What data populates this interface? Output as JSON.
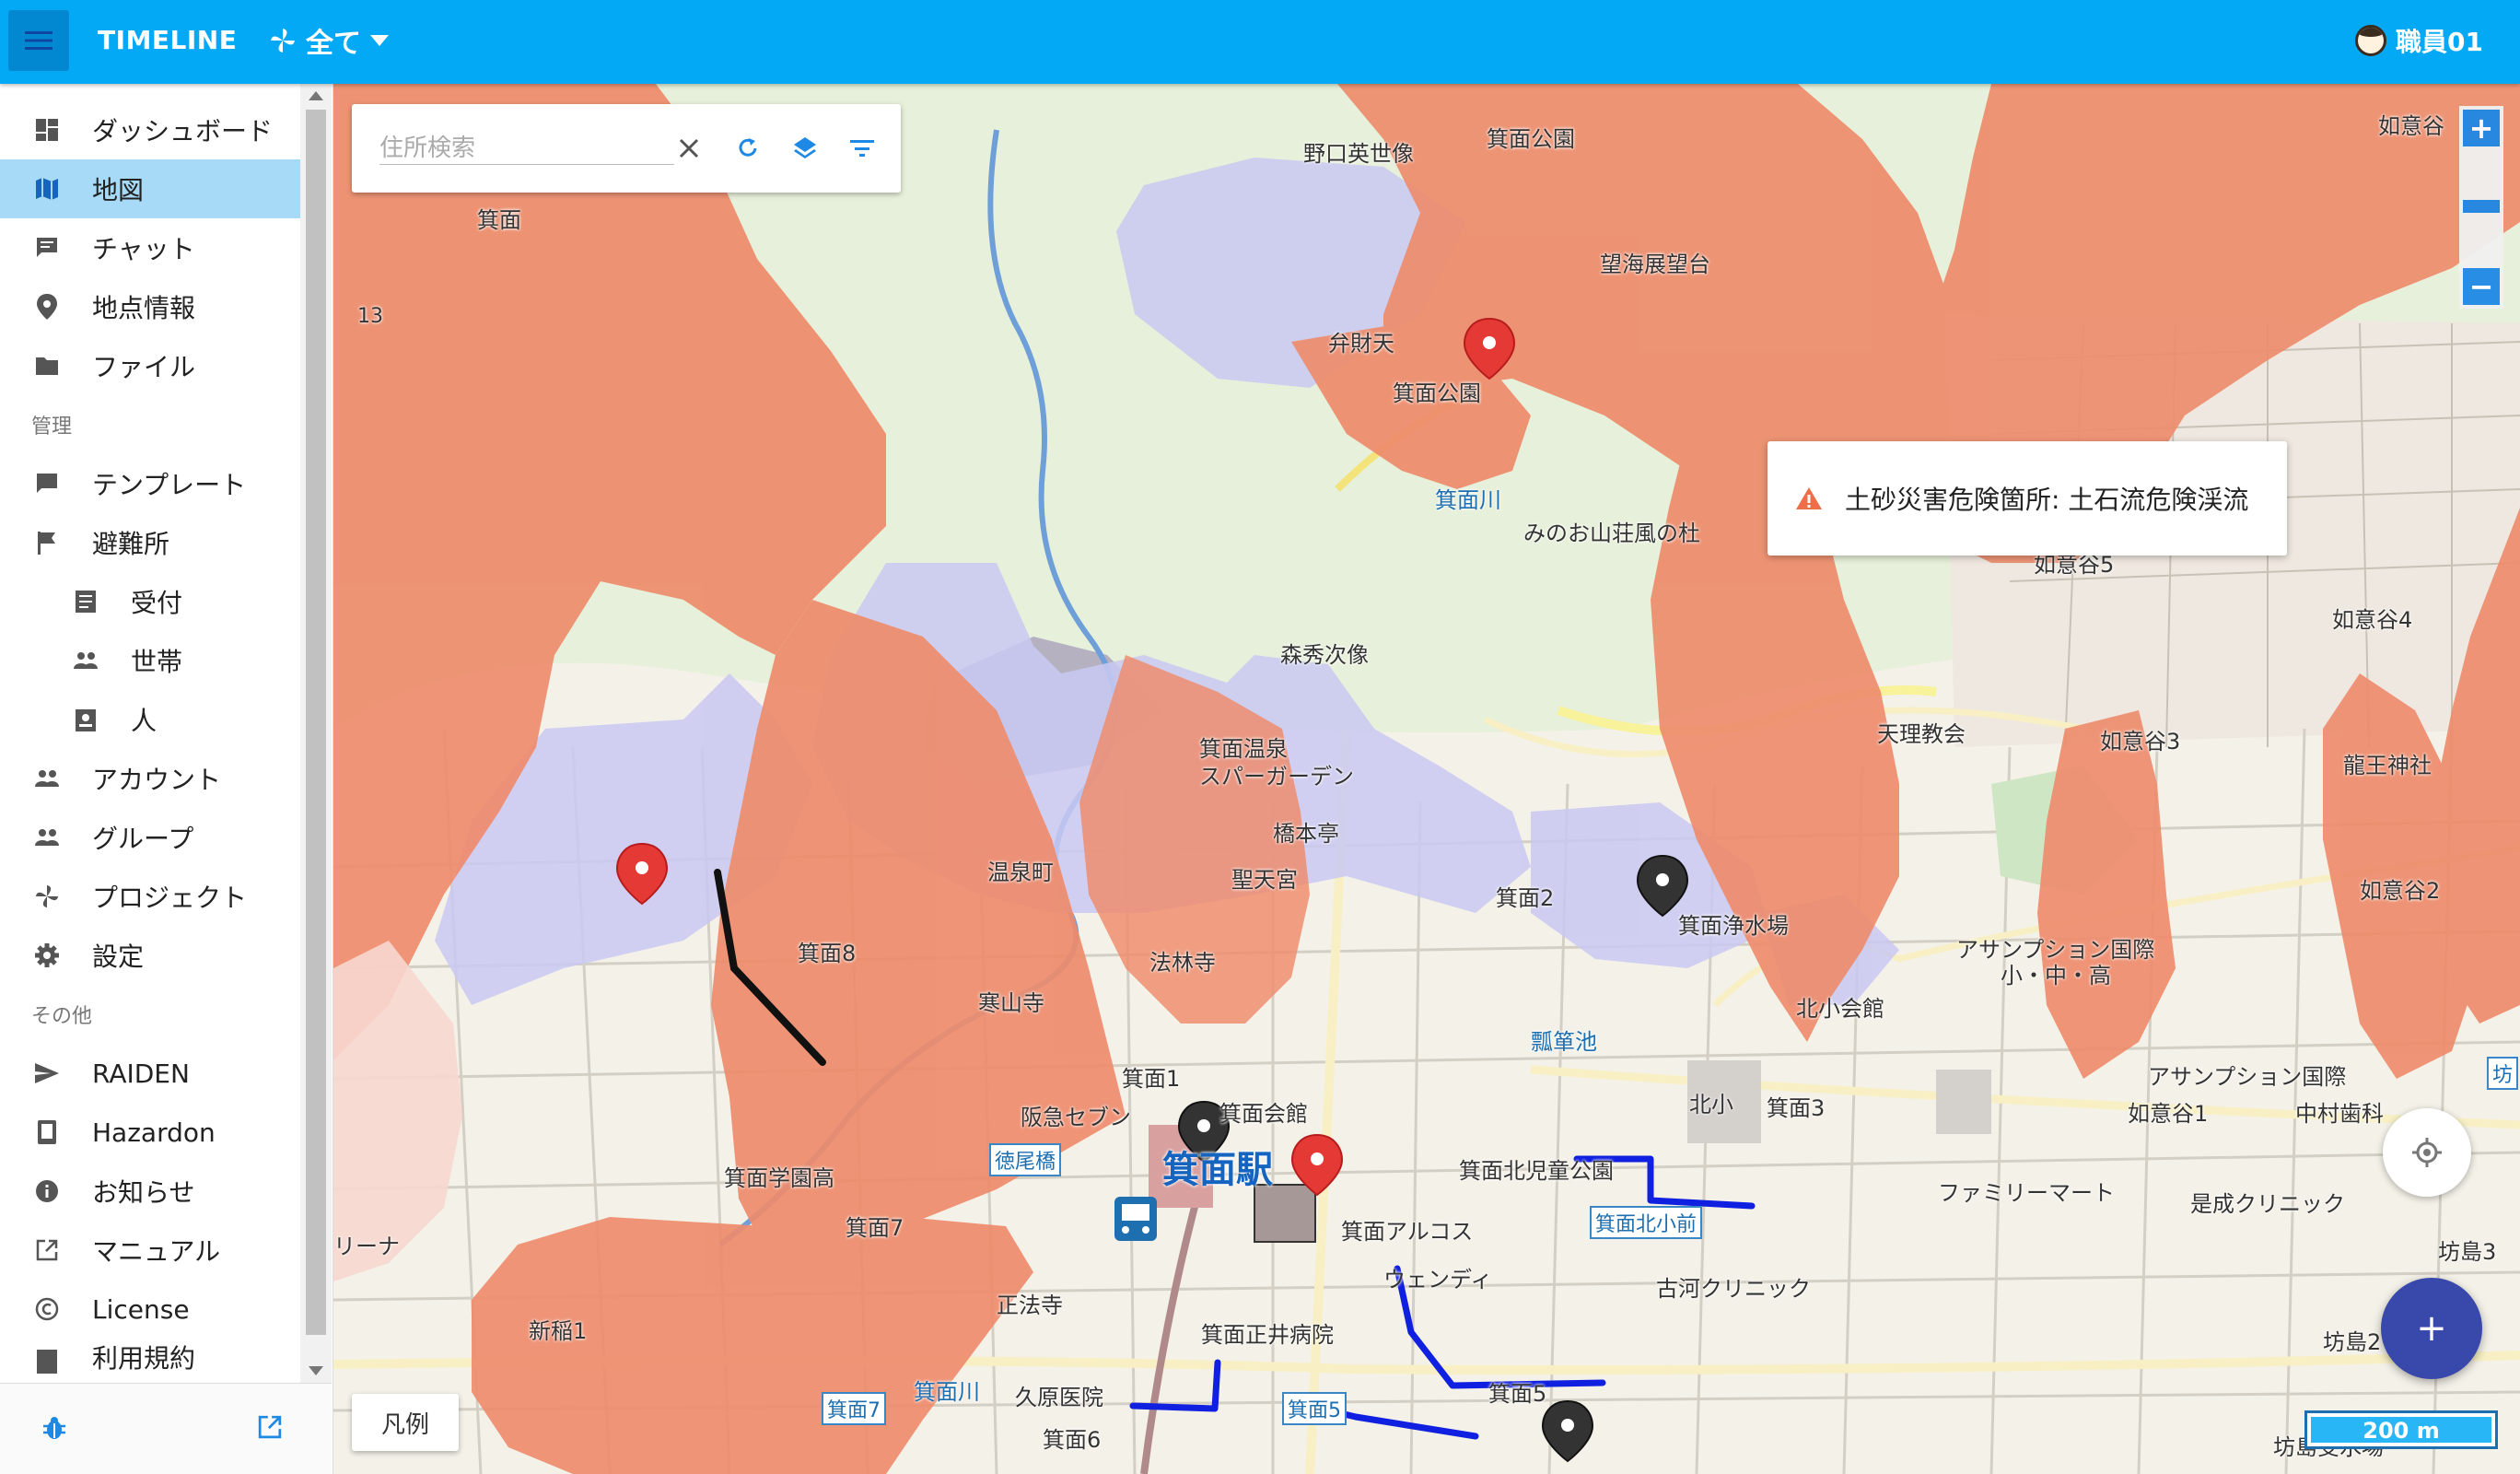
{
  "header": {
    "app_title": "TIMELINE",
    "project_label": "全て",
    "user_name": "職員01"
  },
  "sidebar": {
    "main_items": [
      {
        "label": "ダッシュボード",
        "icon": "dashboard-icon"
      },
      {
        "label": "地図",
        "icon": "map-icon",
        "active": true
      },
      {
        "label": "チャット",
        "icon": "chat-icon"
      },
      {
        "label": "地点情報",
        "icon": "location-pin-icon"
      },
      {
        "label": "ファイル",
        "icon": "folder-icon"
      }
    ],
    "section_admin": "管理",
    "admin_items": [
      {
        "label": "テンプレート",
        "icon": "template-icon"
      },
      {
        "label": "避難所",
        "icon": "flag-icon"
      },
      {
        "label": "受付",
        "icon": "list-icon",
        "sub": true
      },
      {
        "label": "世帯",
        "icon": "people-icon",
        "sub": true
      },
      {
        "label": "人",
        "icon": "badge-icon",
        "sub": true
      },
      {
        "label": "アカウント",
        "icon": "people-icon"
      },
      {
        "label": "グループ",
        "icon": "people-icon"
      },
      {
        "label": "プロジェクト",
        "icon": "pinwheel-icon"
      },
      {
        "label": "設定",
        "icon": "gear-icon"
      }
    ],
    "section_other": "その他",
    "other_items": [
      {
        "label": "RAIDEN",
        "icon": "send-icon"
      },
      {
        "label": "Hazardon",
        "icon": "rss-icon"
      },
      {
        "label": "お知らせ",
        "icon": "info-icon"
      },
      {
        "label": "マニュアル",
        "icon": "external-link-icon"
      },
      {
        "label": "License",
        "icon": "copyright-icon"
      },
      {
        "label": "利用規約",
        "icon": "document-icon"
      }
    ]
  },
  "map": {
    "search_placeholder": "住所検索",
    "tooltip_text": "土砂災害危険箇所: 土石流危険渓流",
    "legend_label": "凡例",
    "scale_label": "200 m",
    "fab_label": "+",
    "zoom_in": "+",
    "zoom_out": "−",
    "colors": {
      "hazard_zone": "#ee8c6c",
      "flood_zone": "#c9c9f2",
      "primary": "#03a9f4",
      "fab": "#3949ab"
    },
    "labels": {
      "station": "箕面駅",
      "minoo": "箕面",
      "minoo_park_n": "箕面公園",
      "noguchi": "野口英世像",
      "bozaiten": "弁財天",
      "minoo_park": "箕面公園",
      "viewpoint": "望海展望台",
      "river_n": "箕面川",
      "minoo_sanso": "みのお山荘風の杜",
      "morishuji": "森秀次像",
      "onsen1": "箕面温泉",
      "onsen2": "スパーガーデン",
      "hashimoto": "橋本亭",
      "onsen_town": "温泉町",
      "shoten": "聖天宮",
      "minoo2": "箕面2",
      "josuijo": "箕面浄水場",
      "tenri": "天理教会",
      "nyoidani5": "如意谷5",
      "nyoidani4": "如意谷4",
      "nyoidani3": "如意谷3",
      "nyoidani2": "如意谷2",
      "nyoidani1": "如意谷1",
      "nyoidani_ne": "如意谷",
      "ryuo": "龍王神社",
      "assumption1": "アサンプション国際",
      "assumption2": "小・中・高",
      "assumption3": "アサンプション国際",
      "kitasho": "北小会館",
      "hyotan": "瓢箪池",
      "kitasho_school": "北小",
      "minoo3": "箕面3",
      "nakamura": "中村歯科",
      "zesei": "是成クリニック",
      "familymart": "ファミリーマート",
      "koga": "古河クリニック",
      "bojima3": "坊島3",
      "bojima2": "坊島2",
      "bojima_water": "坊島受水場",
      "minoo8": "箕面8",
      "hourinji": "法林寺",
      "kanzanji": "寒山寺",
      "minoo1": "箕面1",
      "hankyu": "阪急セブン",
      "kaikan": "箕面会館",
      "tokuobashi": "徳尾橋",
      "gakuen": "箕面学園高",
      "minoo7": "箕面7",
      "shinina1": "新稲1",
      "shoho": "正法寺",
      "masui": "箕面正井病院",
      "kuhara": "久原医院",
      "minoo6": "箕面6",
      "minoo5": "箕面5",
      "river_s": "箕面川",
      "kita_jido": "箕面北児童公園",
      "arcos": "箕面アルコス",
      "wendy": "ウェンディ",
      "kita_kobashi": "箕面北小前",
      "boxed_minoo7": "箕面7",
      "boxed_minoo5": "箕面5",
      "num13": "13",
      "bou": "坊",
      "rina": "リーナ"
    }
  }
}
